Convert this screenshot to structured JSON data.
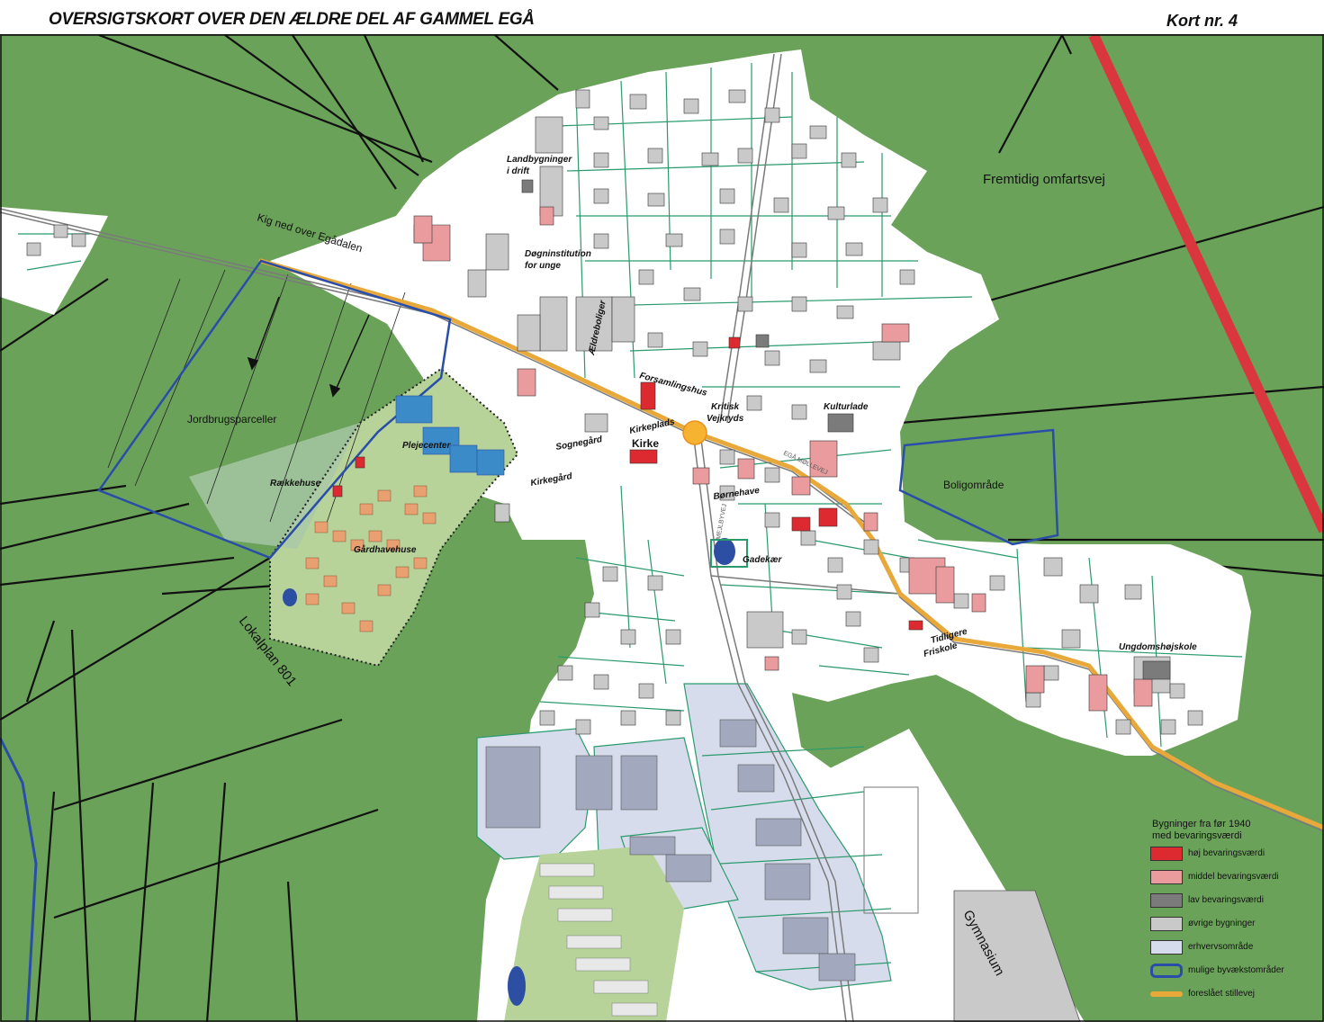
{
  "header": {
    "title": "OVERSIGTSKORT OVER DEN ÆLDRE DEL AF GAMMEL EGÅ",
    "map_number": "Kort nr. 4"
  },
  "colors": {
    "farmland": "#6ba25a",
    "urban": "#ffffff",
    "plot_lines": "#2a9a6c",
    "field_lines": "#111111",
    "high_value": "#dd2a30",
    "medium_value": "#e99b9e",
    "low_value": "#7b7b7b",
    "other_buildings": "#c9c9c9",
    "industrial_area": "#d7dcec",
    "growth_area": "#2a4ea8",
    "quiet_road": "#e8a83a",
    "bypass": "#d9363e",
    "church_square": "#f6b331",
    "pond": "#2c4ea3"
  },
  "labels": {
    "landbygninger": "Landbygninger",
    "i_drift": "i drift",
    "dognins": "Døgninstitution",
    "for_unge": "for unge",
    "aeldreboliger": "Ældreboliger",
    "forsamlingshus": "Forsamlingshus",
    "kritisk": "Kritisk",
    "vejkryds": "Vejkryds",
    "kulturlade": "Kulturlade",
    "kirkeplads": "Kirkeplads",
    "sognegard": "Sognegård",
    "kirke": "Kirke",
    "kirkegard": "Kirkegård",
    "bornehave": "Børnehave",
    "gadekaer": "Gadekær",
    "plejecenter": "Plejecenter",
    "raekkehuse": "Rækkehuse",
    "gardhavehuse": "Gårdhavehuse",
    "jordbrugsparceller": "Jordbrugsparceller",
    "lokalplan": "Lokalplan 801",
    "kig_ned": "Kig ned over Egådalen",
    "fremtidig": "Fremtidig omfartsvej",
    "boligomrade": "Boligområde",
    "tidligere": "Tidligere",
    "friskole": "Friskole",
    "ungdomshojskole": "Ungdomshøjskole",
    "gymnasium": "Gymnasium",
    "mejlbyvej": "MEJLBYVEJ",
    "egaa_mollevej": "EGÅ MØLLEVEJ"
  },
  "legend": {
    "title_line1": "Bygninger fra før 1940",
    "title_line2": "med bevaringsværdi",
    "items": [
      {
        "label": "høj bevaringsværdi"
      },
      {
        "label": "middel bevaringsværdi"
      },
      {
        "label": "lav bevaringsværdi"
      },
      {
        "label": "øvrige bygninger"
      },
      {
        "label": "erhvervsområde"
      },
      {
        "label": "mulige byvækstområder"
      },
      {
        "label": "foreslået stillevej"
      }
    ]
  }
}
